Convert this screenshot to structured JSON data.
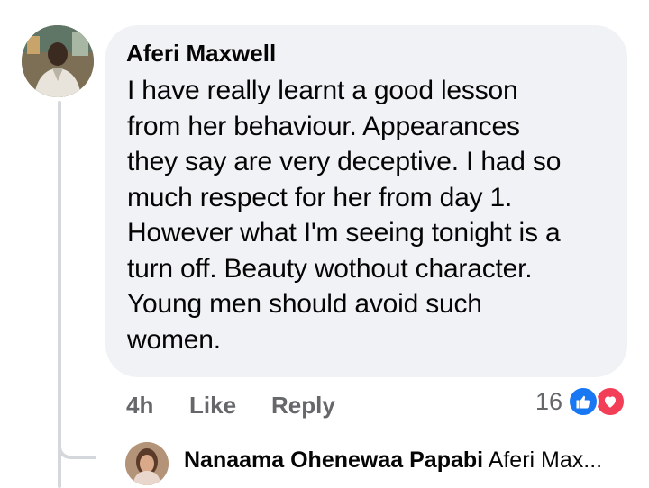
{
  "comment": {
    "author": "Aferi Maxwell",
    "text": "I have really learnt  a good lesson\nfrom her behaviour. Appearances\nthey say are very deceptive. I had so\nmuch respect for her from day 1.\nHowever what I'm seeing tonight is a\nturn off. Beauty wothout character.\nYoung men should avoid such\nwomen.",
    "time": "4h",
    "like_label": "Like",
    "reply_label": "Reply",
    "reaction_count": "16",
    "reaction_icons": [
      "like-icon",
      "love-icon"
    ],
    "colors": {
      "like": "#1877f2",
      "love": "#f33e58",
      "bubble": "#f0f2f5",
      "meta": "#65676b"
    }
  },
  "reply": {
    "author": "Nanaama Ohenewaa Papabi",
    "preview": "Aferi Max..."
  }
}
